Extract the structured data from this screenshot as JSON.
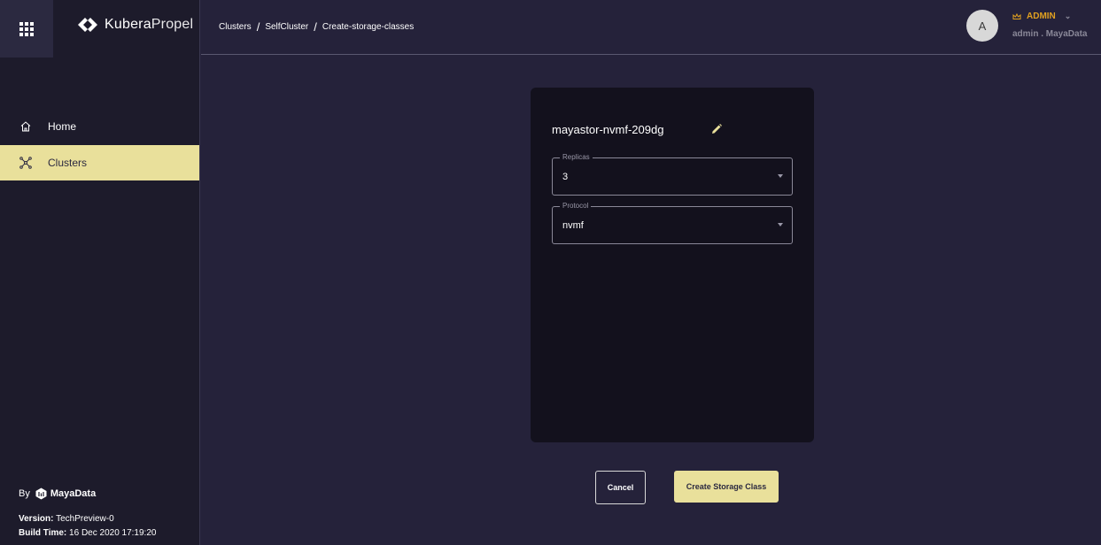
{
  "brand": {
    "name_bold": "Kubera",
    "name_light": "Propel"
  },
  "sidebar": {
    "items": [
      {
        "label": "Home",
        "icon": "home-icon"
      },
      {
        "label": "Clusters",
        "icon": "clusters-icon"
      }
    ],
    "footer": {
      "by": "By",
      "company": "MayaData",
      "version_label": "Version:",
      "version_value": "TechPreview-0",
      "build_label": "Build Time:",
      "build_value": "16 Dec 2020 17:19:20"
    }
  },
  "header": {
    "breadcrumb": [
      "Clusters",
      "SelfCluster",
      "Create-storage-classes"
    ],
    "separator": "/",
    "avatar_initial": "A",
    "role": "ADMIN",
    "account": "admin . MayaData"
  },
  "form": {
    "storage_class_name": "mayastor-nvmf-209dg",
    "replicas": {
      "label": "Replicas",
      "value": "3"
    },
    "protocol": {
      "label": "Protocol",
      "value": "nvmf"
    }
  },
  "actions": {
    "cancel": "Cancel",
    "create": "Create Storage Class"
  },
  "colors": {
    "accent": "#e9e09b",
    "role": "#e0a020",
    "background": "#25223a",
    "sidebar": "#1d1b2b",
    "card": "#13111d"
  }
}
